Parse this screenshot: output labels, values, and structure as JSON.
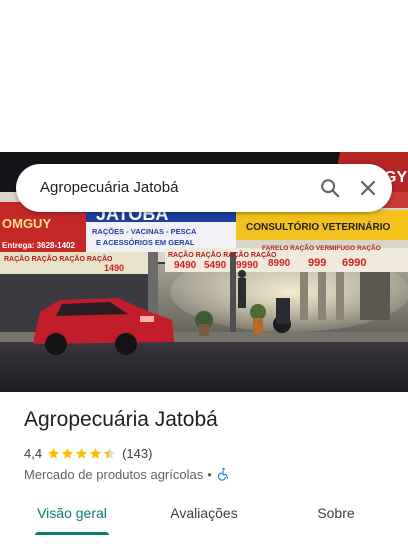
{
  "search": {
    "query": "Agropecuária Jatobá"
  },
  "hero_photo": {
    "sign_store_name": "JATOBÁ",
    "sign_subtitle_1": "RAÇÕES - VACINAS - PESCA",
    "sign_subtitle_2": "E ACESSÓRIOS EM GERAL",
    "sign_brand_left": "OMGUY",
    "sign_phone": "Entrega: 3628-1402",
    "sign_consult": "CONSULTÓRIO VETERINÁRIO",
    "banner_left": "RAÇÃO  RAÇÃO  RAÇÃO  RAÇÃO",
    "banner_mid": "RAÇÃO  RAÇÃO  RAÇÃO  RAÇÃO",
    "banner_right": "FARELO  RAÇÃO  VERMIFUGO  RAÇÃO",
    "price_a": "1490",
    "price_b": "9490",
    "price_c": "5490",
    "price_d": "9990",
    "price_e": "8990",
    "price_f": "999",
    "price_g": "6990",
    "sign_corner_right": "GY"
  },
  "place": {
    "name": "Agropecuária Jatobá",
    "rating": "4,4",
    "stars_filled": 4.4,
    "review_count": "(143)",
    "category": "Mercado de produtos agrícolas",
    "separator": "•"
  },
  "tabs": [
    {
      "label": "Visão geral",
      "active": true
    },
    {
      "label": "Avaliações",
      "active": false
    },
    {
      "label": "Sobre",
      "active": false
    }
  ],
  "colors": {
    "accent": "#0b7a74",
    "star": "#fbbc04",
    "accessibility_icon": "#1a73e8"
  },
  "icons": {
    "search": "search-icon",
    "close": "close-icon",
    "accessibility": "wheelchair-icon"
  }
}
